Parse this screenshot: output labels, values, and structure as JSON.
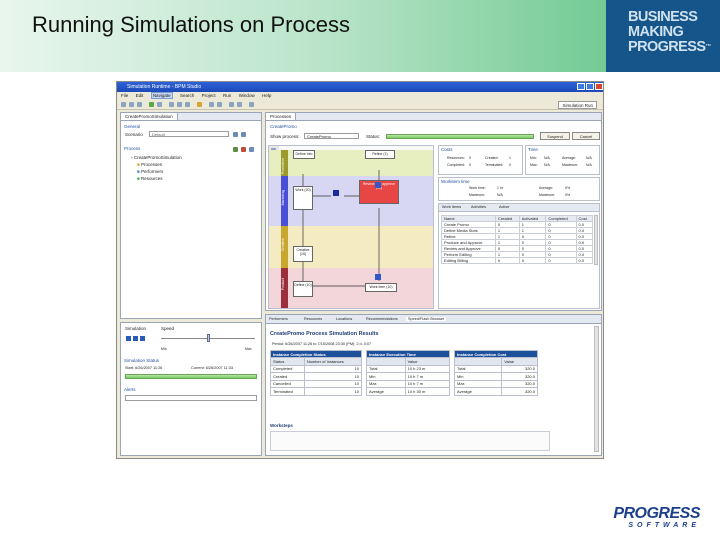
{
  "slide": {
    "title": "Running Simulations on Process",
    "brand": [
      "BUSINESS",
      "MAKING",
      "PROGRESS"
    ],
    "brand_tm": "™",
    "footer_logo_main": "PROGRESS",
    "footer_logo_sub": "SOFTWARE"
  },
  "app": {
    "window_title": "Simulation Runtime - BPM Studio",
    "menu": [
      "File",
      "Edit",
      "Navigate",
      "Search",
      "Project",
      "Run",
      "Window",
      "Help"
    ],
    "active_menu_index": 2,
    "perspective_label": "Simulation Run"
  },
  "left_panel": {
    "tab": "CreatePromoSimulation",
    "section_general": "General",
    "scenario_label": "Scenario",
    "scenario_value": "Default",
    "section_process": "Process",
    "tree_root": "CreatePromoSimulation",
    "tree_items": [
      "Processes",
      "Performers",
      "Resources"
    ],
    "speed_section": "Simulation",
    "speed_label": "Speed",
    "speed_min": "Min",
    "speed_max": "Max",
    "status_section": "Simulation Status",
    "status_start": "Start: 6/26/2007 11:26",
    "status_current": "Current: 6/26/2007 11:33",
    "alerts_section": "Alerts"
  },
  "process_panel": {
    "tab": "Processes",
    "header": "CreatePromo",
    "show_label": "Show process:",
    "show_value": "CreatePromo",
    "status_label": "Status:"
  },
  "buttons": {
    "suspend": "Suspend",
    "cancel": "Cancel"
  },
  "lanes": [
    {
      "label": "Promotion",
      "color": "#9c9a2a"
    },
    {
      "label": "Marketing",
      "color": "#4b4fd6"
    },
    {
      "label": "Creative",
      "color": "#c9a62e"
    },
    {
      "label": "Product",
      "color": "#9b2f3b"
    }
  ],
  "nodes": {
    "n1": "Review and approve (10)",
    "n2": "Define Info",
    "n3": "Refine (1)",
    "n4": "Work (20)",
    "n5": "Creative (15)",
    "n6": "Define (10)",
    "n7": "Work Item (10)",
    "n8": "Produce (10)"
  },
  "cost_box": {
    "title": "Costs",
    "rows": [
      [
        "Resources:",
        "0",
        "Created:",
        "1"
      ],
      [
        "Completed:",
        "0",
        "Terminated:",
        "0"
      ]
    ]
  },
  "time_box": {
    "title": "Time",
    "rows": [
      [
        "Min:",
        "N/A",
        "Average:",
        "N/A"
      ],
      [
        "Max:",
        "N/A",
        "Maximum:",
        "N/A"
      ]
    ]
  },
  "workitem_box": {
    "title": "Workitem time",
    "rows": [
      [
        "Work time:",
        "1 hr",
        "Average:",
        "0%"
      ],
      [
        "Maximum:",
        "N/A",
        "Maximum:",
        "0%"
      ]
    ]
  },
  "worklist": {
    "tabs": [
      "Work Items",
      "Activities",
      "Active"
    ],
    "headers": [
      "Name",
      "Created",
      "Activated",
      "Completed",
      "Cost"
    ],
    "rows": [
      [
        "Create Promo",
        "0",
        "1",
        "0",
        "0.0"
      ],
      [
        "Define Media Slots",
        "1",
        "1",
        "0",
        "0.0"
      ],
      [
        "Refine",
        "1",
        "0",
        "0",
        "0.0"
      ],
      [
        "Produce and Approve",
        "1",
        "0",
        "0",
        "0.0"
      ],
      [
        "Review and Approve",
        "0",
        "0",
        "0",
        "0.0"
      ],
      [
        "Perform Editing",
        "1",
        "0",
        "0",
        "0.0"
      ],
      [
        "Editing Billing",
        "0",
        "0",
        "0",
        "0.0"
      ]
    ]
  },
  "bottom_tabs": [
    "Performers",
    "Resources",
    "Locations",
    "Recommendations",
    "Speed/Flash Browser"
  ],
  "results": {
    "title": "CreatePromo Process Simulation Results",
    "period": "Period: 6/26/2007 11:26 to 7/15/2008 23:30 (PM): 2 d. 0:07",
    "completion_status": {
      "heading": "Instance Completion Status",
      "cols": [
        "Status",
        "Number of Instances"
      ],
      "rows": [
        [
          "Completed",
          "10"
        ],
        [
          "Created",
          "10"
        ],
        [
          "Cancelled",
          "10"
        ],
        [
          "Terminated",
          "10"
        ]
      ]
    },
    "execution_time": {
      "heading": "Instance Execution Time",
      "cols": [
        "",
        "Value"
      ],
      "rows": [
        [
          "Total",
          "10 h 23 m"
        ],
        [
          "Min",
          "10 h 7 m"
        ],
        [
          "Max",
          "10 h 7 m"
        ],
        [
          "Average",
          "10 h 30 m"
        ]
      ]
    },
    "completion_cost": {
      "heading": "Instance Completion Cost",
      "cols": [
        "",
        "Value"
      ],
      "rows": [
        [
          "Total",
          "320.0"
        ],
        [
          "Min",
          "320.0"
        ],
        [
          "Max",
          "320.0"
        ],
        [
          "Average",
          "320.0"
        ]
      ]
    },
    "worksteps_label": "Worksteps"
  }
}
